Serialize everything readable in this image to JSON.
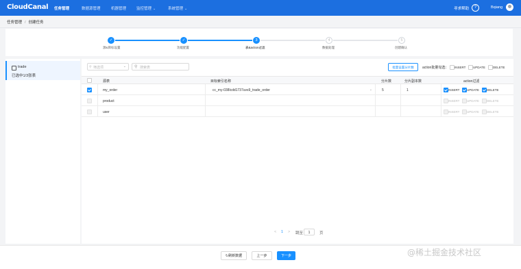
{
  "app": {
    "logo": "CloudCanal"
  },
  "topnav": {
    "items": [
      {
        "label": "任务管理",
        "active": true
      },
      {
        "label": "数据源管理",
        "active": false
      },
      {
        "label": "机器管理",
        "active": false
      },
      {
        "label": "监控管理",
        "active": false,
        "dropdown": true
      },
      {
        "label": "系统管理",
        "active": false,
        "dropdown": true
      }
    ],
    "help_label": "寻求帮助",
    "help_icon": "?",
    "user": "Bqiang"
  },
  "breadcrumb": {
    "parent": "任务管理",
    "current": "创建任务"
  },
  "steps": [
    {
      "label": "源&目标设置",
      "status": "done",
      "number": "1"
    },
    {
      "label": "功能配置",
      "status": "done",
      "number": "2"
    },
    {
      "label": "表&action过滤",
      "status": "current",
      "number": "3"
    },
    {
      "label": "数据处理",
      "status": "todo",
      "number": "4"
    },
    {
      "label": "创建确认",
      "status": "todo",
      "number": "5"
    }
  ],
  "left": {
    "db_name": "trade",
    "selected_summary": "已选中1/3张表"
  },
  "toolbar": {
    "filter_placeholder": "筛选项",
    "search_placeholder": "搜索表",
    "batch_button": "批量设置分片数",
    "batch_label": "action批量勾选：",
    "batch_actions": [
      "INSERT",
      "UPDATE",
      "DELETE"
    ]
  },
  "table": {
    "headers": [
      "源表",
      "目标索引名称",
      "分片数",
      "分片副本数",
      "action过滤"
    ],
    "rows": [
      {
        "checked": true,
        "source": "my_order",
        "target": "cc_my-038lcdd1737uvs9_trade_order",
        "shards": "5",
        "replicas": "1",
        "actions": [
          {
            "label": "INSERT",
            "checked": true
          },
          {
            "label": "UPDATE",
            "checked": true
          },
          {
            "label": "DELETE",
            "checked": true
          }
        ]
      },
      {
        "checked": false,
        "source": "product",
        "target": "",
        "shards": "",
        "replicas": "",
        "actions": [
          {
            "label": "INSERT",
            "checked": false
          },
          {
            "label": "UPDATE",
            "checked": false
          },
          {
            "label": "DELETE",
            "checked": false
          }
        ]
      },
      {
        "checked": false,
        "source": "user",
        "target": "",
        "shards": "",
        "replicas": "",
        "actions": [
          {
            "label": "INSERT",
            "checked": false
          },
          {
            "label": "UPDATE",
            "checked": false
          },
          {
            "label": "DELETE",
            "checked": false
          }
        ]
      }
    ]
  },
  "pagination": {
    "prev": "<",
    "current": "1",
    "next": ">",
    "goto_prefix": "跳至",
    "goto_value": "1",
    "goto_suffix": "页"
  },
  "footer": {
    "refresh": "刷新数据",
    "prev": "上一步",
    "next": "下一步"
  },
  "watermark": "@稀土掘金技术社区"
}
